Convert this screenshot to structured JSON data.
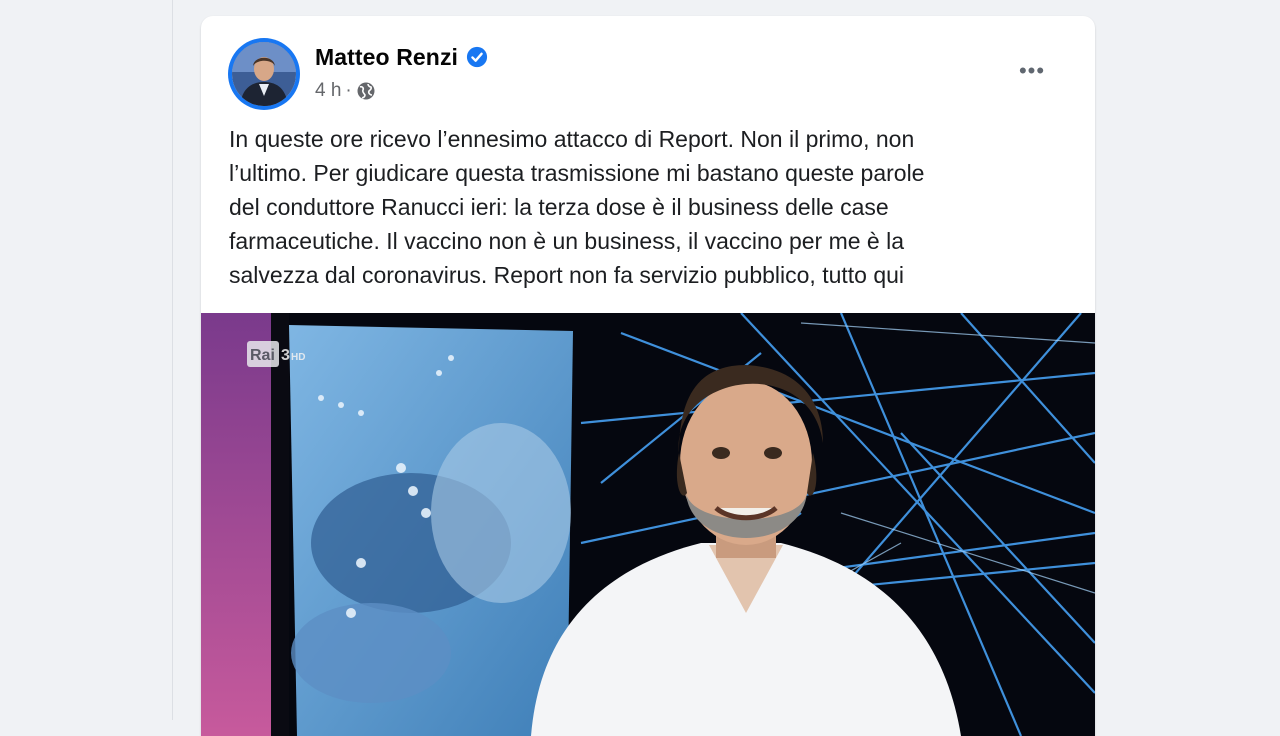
{
  "post": {
    "author": "Matteo Renzi",
    "time": "4 h",
    "separator": "·",
    "more_label": "•••",
    "text": "In queste ore ricevo l’ennesimo attacco di Report. Non il primo, non\nl’ultimo. Per giudicare questa trasmissione mi bastano queste parole\ndel conduttore Ranucci ieri: la terza dose è il business delle case\nfarmaceutiche. Il vaccino non è un business, il vaccino per me è la\nsalvezza dal coronavirus. Report non fa servizio pubblico, tutto qui",
    "icons": {
      "verified": "verified-badge-icon",
      "audience": "globe-icon",
      "more": "more-options-icon"
    }
  },
  "media": {
    "channel_logo": "Rai",
    "channel_number": "3",
    "channel_suffix": "HD"
  },
  "colors": {
    "accent": "#1877f2",
    "text_primary": "#050505",
    "text_secondary": "#65676b",
    "background": "#f0f2f5"
  }
}
